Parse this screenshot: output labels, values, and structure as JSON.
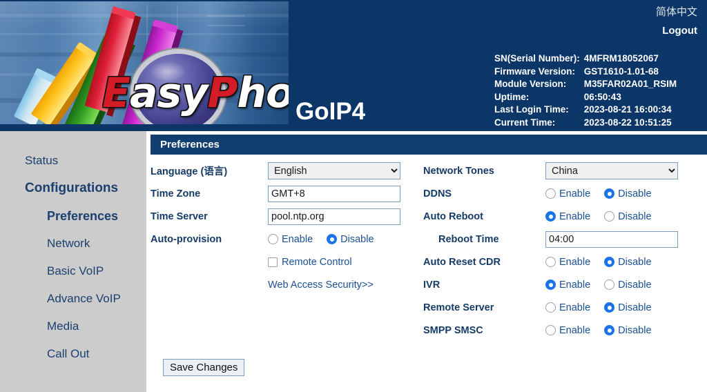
{
  "banner": {
    "logo_wordmark": [
      {
        "t": "E",
        "red": true
      },
      {
        "t": "asy",
        "red": false
      },
      {
        "t": "P",
        "red": true
      },
      {
        "t": "hone",
        "red": false
      }
    ],
    "model_title": "GoIP4",
    "language_link": "简体中文",
    "logout_link": "Logout",
    "sysinfo": [
      {
        "key": "SN(Serial Number):",
        "value": "4MFRM18052067"
      },
      {
        "key": "Firmware Version:",
        "value": "GST1610-1.01-68"
      },
      {
        "key": "Module Version:",
        "value": "M35FAR02A01_RSIM"
      },
      {
        "key": "Uptime:",
        "value": "06:50:43"
      },
      {
        "key": "Last Login Time:",
        "value": "2023-08-21 16:00:34"
      },
      {
        "key": "Current Time:",
        "value": "2023-08-22 10:51:25"
      }
    ]
  },
  "sidebar": {
    "items": [
      {
        "label": "Status",
        "level": 0,
        "active": false,
        "bold": false
      },
      {
        "label": "Configurations",
        "level": 0,
        "active": false,
        "bold": true
      },
      {
        "label": "Preferences",
        "level": 1,
        "active": true,
        "bold": true
      },
      {
        "label": "Network",
        "level": 1,
        "active": false,
        "bold": false
      },
      {
        "label": "Basic VoIP",
        "level": 1,
        "active": false,
        "bold": false
      },
      {
        "label": "Advance VoIP",
        "level": 1,
        "active": false,
        "bold": false
      },
      {
        "label": "Media",
        "level": 1,
        "active": false,
        "bold": false
      },
      {
        "label": "Call Out",
        "level": 1,
        "active": false,
        "bold": false
      }
    ]
  },
  "panel": {
    "title": "Preferences",
    "left": {
      "language_label": "Language (语言)",
      "language_value": "English",
      "language_options": [
        "English"
      ],
      "timezone_label": "Time Zone",
      "timezone_value": "GMT+8",
      "timeserver_label": "Time Server",
      "timeserver_value": "pool.ntp.org",
      "autoprovision_label": "Auto-provision",
      "autoprovision_enable": "Enable",
      "autoprovision_disable": "Disable",
      "autoprovision_selected": "Disable",
      "remote_control_label": "Remote Control",
      "remote_control_checked": false,
      "web_access_security_link": "Web Access Security>>"
    },
    "right": {
      "network_tones_label": "Network Tones",
      "network_tones_value": "China",
      "network_tones_options": [
        "China"
      ],
      "ddns_label": "DDNS",
      "ddns_enable": "Enable",
      "ddns_disable": "Disable",
      "ddns_selected": "Disable",
      "auto_reboot_label": "Auto Reboot",
      "auto_reboot_enable": "Enable",
      "auto_reboot_disable": "Disable",
      "auto_reboot_selected": "Enable",
      "reboot_time_label": "Reboot Time",
      "reboot_time_value": "04:00",
      "auto_reset_cdr_label": "Auto Reset CDR",
      "auto_reset_cdr_enable": "Enable",
      "auto_reset_cdr_disable": "Disable",
      "auto_reset_cdr_selected": "Disable",
      "ivr_label": "IVR",
      "ivr_enable": "Enable",
      "ivr_disable": "Disable",
      "ivr_selected": "Enable",
      "remote_server_label": "Remote Server",
      "remote_server_enable": "Enable",
      "remote_server_disable": "Disable",
      "remote_server_selected": "Disable",
      "smpp_smsc_label": "SMPP SMSC",
      "smpp_smsc_enable": "Enable",
      "smpp_smsc_disable": "Disable",
      "smpp_smsc_selected": "Disable"
    },
    "save_label": "Save Changes"
  },
  "colors": {
    "banner_navy": "#0b3667",
    "panel_header_navy": "#103f70",
    "sidebar_gray": "#cccccc",
    "label_navy": "#153b66",
    "link_blue": "#1b4f93",
    "radio_blue": "#1a73e8"
  }
}
